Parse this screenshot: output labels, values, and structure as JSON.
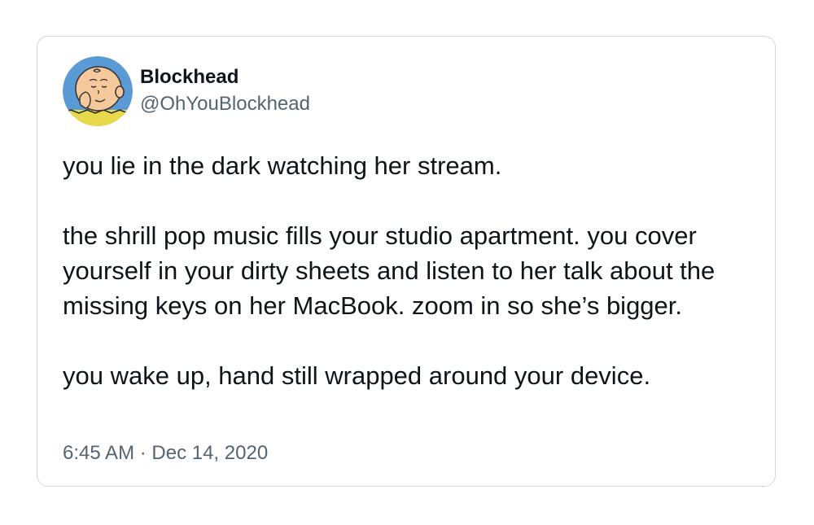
{
  "author": {
    "display_name": "Blockhead",
    "handle": "@OhYouBlockhead",
    "avatar_icon": "charlie-brown-avatar-icon"
  },
  "tweet": {
    "paragraphs": [
      "you lie in the dark watching her stream.",
      "the shrill pop music fills your studio apartment. you cover yourself in your dirty sheets and listen to her talk about the missing keys on her MacBook. zoom in so she’s bigger.",
      "you wake up, hand still wrapped around your device."
    ],
    "time": "6:45 AM",
    "separator": "·",
    "date": "Dec 14, 2020"
  },
  "colors": {
    "text_primary": "#0f1419",
    "text_secondary": "#536471",
    "border": "#cfd9de",
    "avatar_bg": "#5b9bd5",
    "skin": "#f5c99b",
    "shirt": "#e8d94a"
  }
}
